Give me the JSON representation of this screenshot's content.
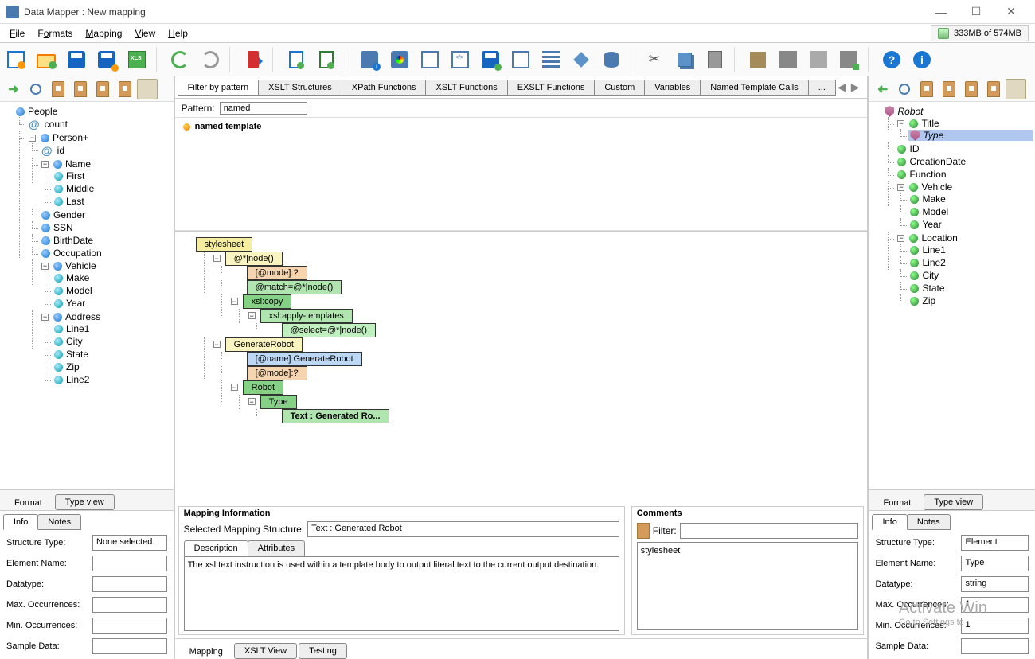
{
  "title": "Data Mapper : New mapping",
  "menu": [
    "File",
    "Formats",
    "Mapping",
    "View",
    "Help"
  ],
  "memory": "333MB of 574MB",
  "leftTree": {
    "root": "People",
    "count": "count",
    "person": "Person+",
    "id": "id",
    "name": "Name",
    "first": "First",
    "middle": "Middle",
    "last": "Last",
    "gender": "Gender",
    "ssn": "SSN",
    "bdate": "BirthDate",
    "occ": "Occupation",
    "vehicle": "Vehicle",
    "make": "Make",
    "model": "Model",
    "year": "Year",
    "address": "Address",
    "line1": "Line1",
    "city": "City",
    "state": "State",
    "zip": "Zip",
    "line2": "Line2"
  },
  "rightTree": {
    "root": "Robot",
    "title": "Title",
    "type": "Type",
    "id": "ID",
    "cdate": "CreationDate",
    "func": "Function",
    "vehicle": "Vehicle",
    "make": "Make",
    "model": "Model",
    "year": "Year",
    "location": "Location",
    "line1": "Line1",
    "line2": "Line2",
    "city": "City",
    "state": "State",
    "zip": "Zip"
  },
  "funcTabs": [
    "Filter by pattern",
    "XSLT Structures",
    "XPath Functions",
    "XSLT Functions",
    "EXSLT Functions",
    "Custom",
    "Variables",
    "Named Template Calls",
    "..."
  ],
  "patternLabel": "Pattern:",
  "patternValue": "named",
  "patternResult": "named template",
  "diagram": {
    "stylesheet": "stylesheet",
    "node1": "@*|node()",
    "mode": "[@mode]:?",
    "match": "@match=@*|node()",
    "xslcopy": "xsl:copy",
    "apply": "xsl:apply-templates",
    "select": "@select=@*|node()",
    "gen": "GenerateRobot",
    "namegen": "[@name]:GenerateRobot",
    "mode2": "[@mode]:?",
    "robot": "Robot",
    "type": "Type",
    "text": "Text : Generated Ro..."
  },
  "tabsFormat": {
    "format": "Format",
    "typeview": "Type view"
  },
  "infoTabs": {
    "info": "Info",
    "notes": "Notes"
  },
  "leftInfo": {
    "structType": "Structure Type:",
    "structTypeVal": "None selected.",
    "elName": "Element Name:",
    "elNameVal": "",
    "dtype": "Datatype:",
    "dtypeVal": "",
    "maxo": "Max. Occurrences:",
    "maxoVal": "",
    "mino": "Min. Occurrences:",
    "minoVal": "",
    "sd": "Sample Data:",
    "sdVal": ""
  },
  "rightInfo": {
    "structType": "Structure Type:",
    "structTypeVal": "Element",
    "elName": "Element Name:",
    "elNameVal": "Type",
    "dtype": "Datatype:",
    "dtypeVal": "string",
    "maxo": "Max. Occurrences:",
    "maxoVal": "1",
    "mino": "Min. Occurrences:",
    "minoVal": "1",
    "sd": "Sample Data:",
    "sdVal": ""
  },
  "mappingInfo": {
    "title": "Mapping Information",
    "selLabel": "Selected Mapping Structure:",
    "selVal": "Text : Generated Robot",
    "descTab": "Description",
    "attrTab": "Attributes",
    "desc": "The xsl:text instruction is used within a template body to output literal text to the current output destination."
  },
  "comments": {
    "title": "Comments",
    "filterLabel": "Filter:",
    "item": "stylesheet"
  },
  "bottomTabs": {
    "mapping": "Mapping",
    "xslt": "XSLT View",
    "testing": "Testing"
  },
  "watermark": {
    "t1": "Activate Win",
    "t2": "Go to Settings to"
  }
}
